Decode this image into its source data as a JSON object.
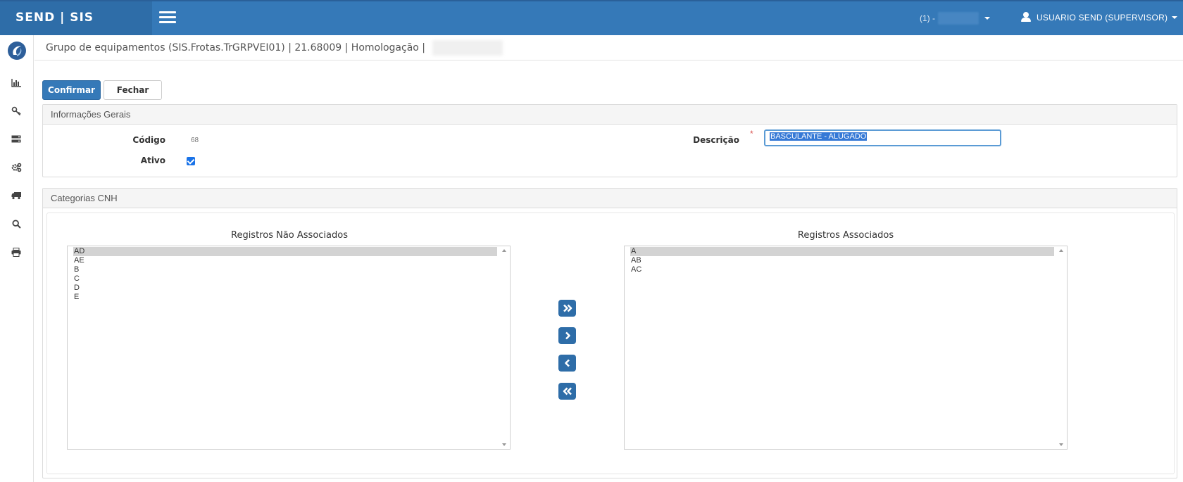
{
  "app": {
    "brand": "SEND | SIS"
  },
  "topbar": {
    "env_label": "(1) -",
    "user_label": "USUARIO SEND (SUPERVISOR)"
  },
  "header": {
    "title": "Grupo de equipamentos (SIS.Frotas.TrGRPVEI01) | 21.68009 | Homologação |"
  },
  "toolbar": {
    "confirm_label": "Confirmar",
    "close_label": "Fechar"
  },
  "general": {
    "heading": "Informações Gerais",
    "code_label": "Código",
    "code_value": "68",
    "active_label": "Ativo",
    "active_checked": true,
    "description_label": "Descrição",
    "required_mark": "*",
    "description_value": "BASCULANTE - ALUGADO"
  },
  "cnh": {
    "heading": "Categorias CNH",
    "unassociated_title": "Registros Não Associados",
    "associated_title": "Registros Associados",
    "unassociated": [
      "AD",
      "AE",
      "B",
      "C",
      "D",
      "E"
    ],
    "associated": [
      "A",
      "AB",
      "AC"
    ]
  },
  "colors": {
    "primary": "#3579b8",
    "brand_bg": "#2e6da8",
    "required": "#d9534f"
  }
}
